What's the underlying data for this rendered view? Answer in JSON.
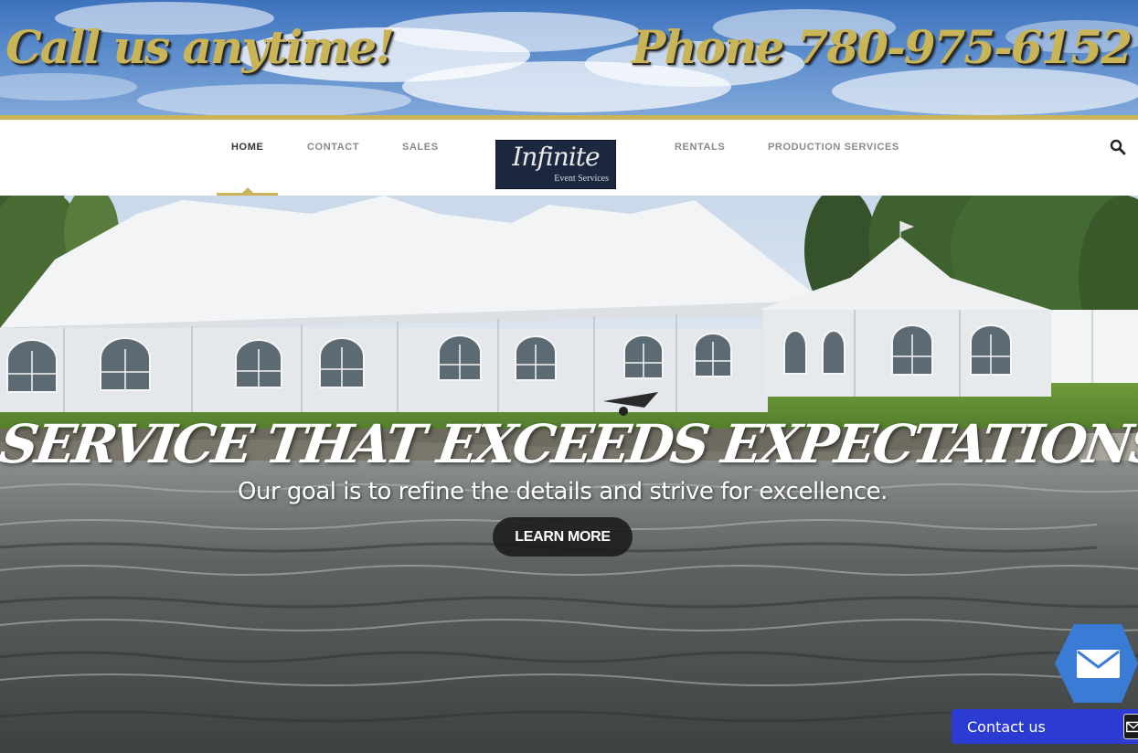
{
  "banner": {
    "left_text": "Call us anytime!",
    "right_text": "Phone 780-975-6152",
    "text_color": "#c9b458",
    "accent_line_color": "#c9b458"
  },
  "nav": {
    "items": [
      {
        "label": "HOME",
        "active": true
      },
      {
        "label": "CONTACT",
        "active": false
      },
      {
        "label": "SALES",
        "active": false
      },
      {
        "label": "RENTALS",
        "active": false
      },
      {
        "label": "PRODUCTION SERVICES",
        "active": false
      }
    ],
    "logo": {
      "script": "Infinite",
      "subtitle": "Event Services",
      "background": "#1c2840"
    },
    "search_icon": "search-icon"
  },
  "hero": {
    "title": "SERVICE THAT EXCEEDS EXPECTATIONS!",
    "subtitle": "Our goal is to refine the details and strive for excellence.",
    "cta_label": "LEARN MORE"
  },
  "widgets": {
    "mail_icon": "envelope-icon",
    "mail_color": "#3a7bd5",
    "contact_label": "Contact us",
    "contact_color": "#2c3bd1"
  }
}
